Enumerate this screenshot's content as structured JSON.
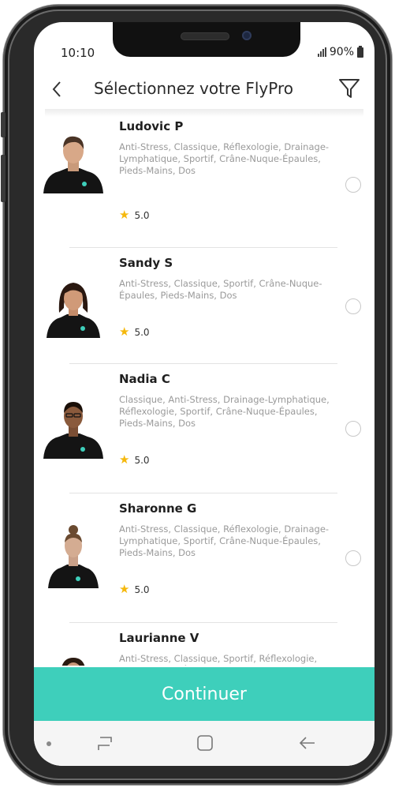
{
  "status_bar": {
    "time": "10:10",
    "battery": "90%"
  },
  "header": {
    "title": "Sélectionnez votre FlyPro",
    "back_icon": "chevron-left-icon",
    "filter_icon": "filter-icon"
  },
  "pros": [
    {
      "name": "Ludovic P",
      "specialties": "Anti-Stress, Classique, Réflexologie, Drainage-Lymphatique, Sportif, Crâne-Nuque-Épaules, Pieds-Mains, Dos",
      "rating": "5.0"
    },
    {
      "name": "Sandy S",
      "specialties": "Anti-Stress, Classique, Sportif, Crâne-Nuque-Épaules, Pieds-Mains, Dos",
      "rating": "5.0"
    },
    {
      "name": "Nadia C",
      "specialties": "Classique, Anti-Stress, Drainage-Lymphatique, Réflexologie, Sportif, Crâne-Nuque-Épaules, Pieds-Mains, Dos",
      "rating": "5.0"
    },
    {
      "name": "Sharonne G",
      "specialties": "Anti-Stress, Classique, Réflexologie, Drainage-Lymphatique, Sportif, Crâne-Nuque-Épaules, Pieds-Mains, Dos",
      "rating": "5.0"
    },
    {
      "name": "Laurianne V",
      "specialties": "Anti-Stress, Classique, Sportif, Réflexologie, Crâne-Nuque-Épaules,",
      "rating": ""
    }
  ],
  "continue_button": {
    "label": "Continuer"
  },
  "colors": {
    "accent": "#3ecfbb",
    "star": "#f5b80c"
  }
}
